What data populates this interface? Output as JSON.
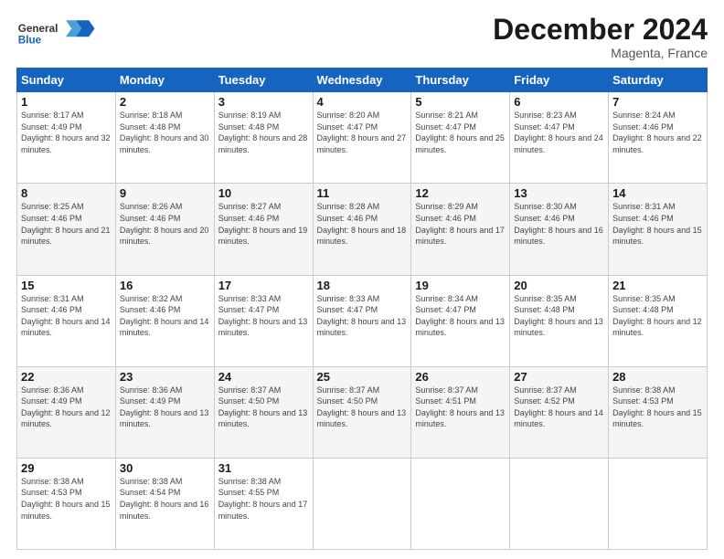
{
  "header": {
    "logo_general": "General",
    "logo_blue": "Blue",
    "month_title": "December 2024",
    "location": "Magenta, France"
  },
  "weekdays": [
    "Sunday",
    "Monday",
    "Tuesday",
    "Wednesday",
    "Thursday",
    "Friday",
    "Saturday"
  ],
  "weeks": [
    [
      {
        "day": "1",
        "sunrise": "8:17 AM",
        "sunset": "4:49 PM",
        "daylight": "8 hours and 32 minutes."
      },
      {
        "day": "2",
        "sunrise": "8:18 AM",
        "sunset": "4:48 PM",
        "daylight": "8 hours and 30 minutes."
      },
      {
        "day": "3",
        "sunrise": "8:19 AM",
        "sunset": "4:48 PM",
        "daylight": "8 hours and 28 minutes."
      },
      {
        "day": "4",
        "sunrise": "8:20 AM",
        "sunset": "4:47 PM",
        "daylight": "8 hours and 27 minutes."
      },
      {
        "day": "5",
        "sunrise": "8:21 AM",
        "sunset": "4:47 PM",
        "daylight": "8 hours and 25 minutes."
      },
      {
        "day": "6",
        "sunrise": "8:23 AM",
        "sunset": "4:47 PM",
        "daylight": "8 hours and 24 minutes."
      },
      {
        "day": "7",
        "sunrise": "8:24 AM",
        "sunset": "4:46 PM",
        "daylight": "8 hours and 22 minutes."
      }
    ],
    [
      {
        "day": "8",
        "sunrise": "8:25 AM",
        "sunset": "4:46 PM",
        "daylight": "8 hours and 21 minutes."
      },
      {
        "day": "9",
        "sunrise": "8:26 AM",
        "sunset": "4:46 PM",
        "daylight": "8 hours and 20 minutes."
      },
      {
        "day": "10",
        "sunrise": "8:27 AM",
        "sunset": "4:46 PM",
        "daylight": "8 hours and 19 minutes."
      },
      {
        "day": "11",
        "sunrise": "8:28 AM",
        "sunset": "4:46 PM",
        "daylight": "8 hours and 18 minutes."
      },
      {
        "day": "12",
        "sunrise": "8:29 AM",
        "sunset": "4:46 PM",
        "daylight": "8 hours and 17 minutes."
      },
      {
        "day": "13",
        "sunrise": "8:30 AM",
        "sunset": "4:46 PM",
        "daylight": "8 hours and 16 minutes."
      },
      {
        "day": "14",
        "sunrise": "8:31 AM",
        "sunset": "4:46 PM",
        "daylight": "8 hours and 15 minutes."
      }
    ],
    [
      {
        "day": "15",
        "sunrise": "8:31 AM",
        "sunset": "4:46 PM",
        "daylight": "8 hours and 14 minutes."
      },
      {
        "day": "16",
        "sunrise": "8:32 AM",
        "sunset": "4:46 PM",
        "daylight": "8 hours and 14 minutes."
      },
      {
        "day": "17",
        "sunrise": "8:33 AM",
        "sunset": "4:47 PM",
        "daylight": "8 hours and 13 minutes."
      },
      {
        "day": "18",
        "sunrise": "8:33 AM",
        "sunset": "4:47 PM",
        "daylight": "8 hours and 13 minutes."
      },
      {
        "day": "19",
        "sunrise": "8:34 AM",
        "sunset": "4:47 PM",
        "daylight": "8 hours and 13 minutes."
      },
      {
        "day": "20",
        "sunrise": "8:35 AM",
        "sunset": "4:48 PM",
        "daylight": "8 hours and 13 minutes."
      },
      {
        "day": "21",
        "sunrise": "8:35 AM",
        "sunset": "4:48 PM",
        "daylight": "8 hours and 12 minutes."
      }
    ],
    [
      {
        "day": "22",
        "sunrise": "8:36 AM",
        "sunset": "4:49 PM",
        "daylight": "8 hours and 12 minutes."
      },
      {
        "day": "23",
        "sunrise": "8:36 AM",
        "sunset": "4:49 PM",
        "daylight": "8 hours and 13 minutes."
      },
      {
        "day": "24",
        "sunrise": "8:37 AM",
        "sunset": "4:50 PM",
        "daylight": "8 hours and 13 minutes."
      },
      {
        "day": "25",
        "sunrise": "8:37 AM",
        "sunset": "4:50 PM",
        "daylight": "8 hours and 13 minutes."
      },
      {
        "day": "26",
        "sunrise": "8:37 AM",
        "sunset": "4:51 PM",
        "daylight": "8 hours and 13 minutes."
      },
      {
        "day": "27",
        "sunrise": "8:37 AM",
        "sunset": "4:52 PM",
        "daylight": "8 hours and 14 minutes."
      },
      {
        "day": "28",
        "sunrise": "8:38 AM",
        "sunset": "4:53 PM",
        "daylight": "8 hours and 15 minutes."
      }
    ],
    [
      {
        "day": "29",
        "sunrise": "8:38 AM",
        "sunset": "4:53 PM",
        "daylight": "8 hours and 15 minutes."
      },
      {
        "day": "30",
        "sunrise": "8:38 AM",
        "sunset": "4:54 PM",
        "daylight": "8 hours and 16 minutes."
      },
      {
        "day": "31",
        "sunrise": "8:38 AM",
        "sunset": "4:55 PM",
        "daylight": "8 hours and 17 minutes."
      },
      null,
      null,
      null,
      null
    ]
  ]
}
